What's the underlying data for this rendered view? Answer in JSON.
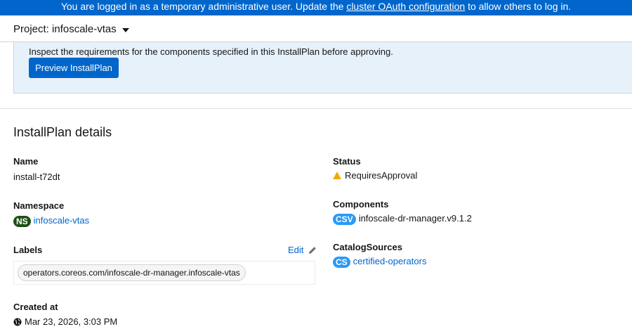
{
  "banner": {
    "prefix": "You are logged in as a temporary administrative user. Update the ",
    "link": "cluster OAuth configuration",
    "suffix": " to allow others to log in."
  },
  "project": {
    "label": "Project: infoscale-vtas"
  },
  "alert": {
    "text": "Inspect the requirements for the components specified in this InstallPlan before approving.",
    "button_label": "Preview InstallPlan"
  },
  "details": {
    "title": "InstallPlan details",
    "name": {
      "label": "Name",
      "value": "install-t72dt"
    },
    "namespace": {
      "label": "Namespace",
      "badge": "NS",
      "value": "infoscale-vtas"
    },
    "labels": {
      "label": "Labels",
      "edit": "Edit",
      "items": [
        "operators.coreos.com/infoscale-dr-manager.infoscale-vtas"
      ]
    },
    "created": {
      "label": "Created at",
      "value": "Mar 23, 2026, 3:03 PM"
    },
    "status": {
      "label": "Status",
      "value": "RequiresApproval"
    },
    "components": {
      "label": "Components",
      "badge": "CSV",
      "value": "infoscale-dr-manager.v9.1.2"
    },
    "catalog_sources": {
      "label": "CatalogSources",
      "badge": "CS",
      "value": "certified-operators"
    }
  },
  "colors": {
    "accent": "#0066cc",
    "warning": "#f0ab00",
    "namespace_badge": "#1e4f18",
    "resource_badge": "#2b9af3"
  }
}
